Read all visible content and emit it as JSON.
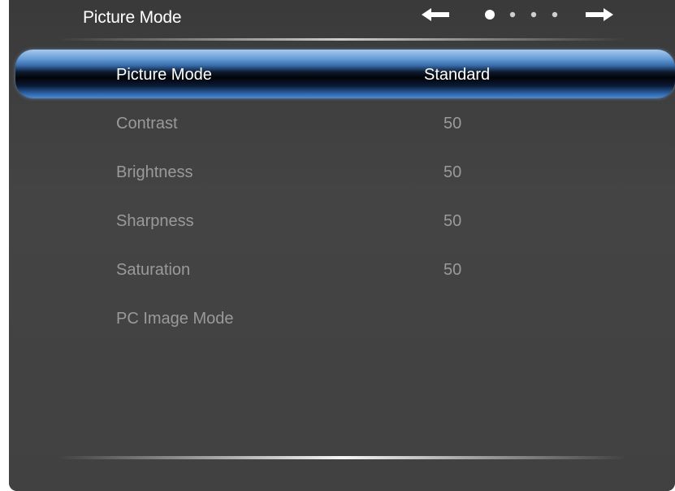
{
  "header": {
    "title": "Picture Mode",
    "nav": {
      "left_arrow_icon": "arrow-left-icon",
      "right_arrow_icon": "arrow-right-icon",
      "page_count": 4,
      "active_page": 1
    }
  },
  "menu": {
    "items": [
      {
        "label": "Picture Mode",
        "value": "Standard",
        "selected": true
      },
      {
        "label": "Contrast",
        "value": "50"
      },
      {
        "label": "Brightness",
        "value": "50"
      },
      {
        "label": "Sharpness",
        "value": "50"
      },
      {
        "label": "Saturation",
        "value": "50"
      },
      {
        "label": "PC Image Mode",
        "value": ""
      }
    ]
  },
  "colors": {
    "panel_background": "#414141",
    "text_active": "#ffffff",
    "text_inactive": "#9a9a9a",
    "selection_accent": "#3a6fb0"
  }
}
